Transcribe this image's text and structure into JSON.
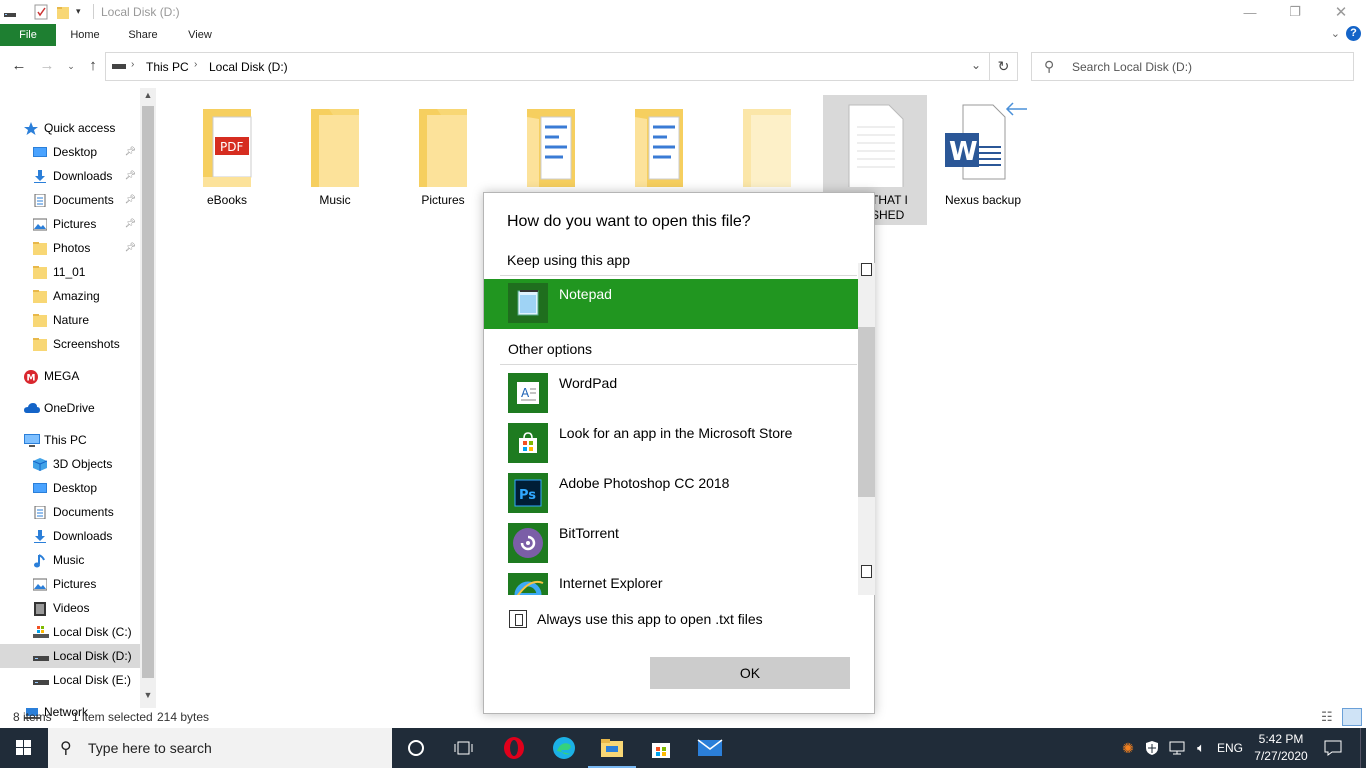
{
  "window": {
    "title": "Local Disk (D:)",
    "controls": {
      "minimize": "—",
      "maximize": "❐",
      "close": "✕"
    }
  },
  "ribbon": {
    "tabs": [
      "File",
      "Home",
      "Share",
      "View"
    ],
    "help": "?"
  },
  "address": {
    "crumbs": [
      "This PC",
      "Local Disk (D:)"
    ],
    "search_placeholder": "Search Local Disk (D:)"
  },
  "nav": {
    "items": [
      {
        "label": "Quick access",
        "icon": "star-icon",
        "pinned": false,
        "level": 0
      },
      {
        "label": "Desktop",
        "icon": "desktop-icon",
        "pinned": true,
        "level": 1
      },
      {
        "label": "Downloads",
        "icon": "download-icon",
        "pinned": true,
        "level": 1
      },
      {
        "label": "Documents",
        "icon": "documents-icon",
        "pinned": true,
        "level": 1
      },
      {
        "label": "Pictures",
        "icon": "pictures-icon",
        "pinned": true,
        "level": 1
      },
      {
        "label": "Photos",
        "icon": "folder-icon",
        "pinned": true,
        "level": 1
      },
      {
        "label": "11_01",
        "icon": "folder-icon",
        "pinned": false,
        "level": 1
      },
      {
        "label": "Amazing",
        "icon": "folder-icon",
        "pinned": false,
        "level": 1
      },
      {
        "label": "Nature",
        "icon": "folder-icon",
        "pinned": false,
        "level": 1
      },
      {
        "label": "Screenshots",
        "icon": "folder-icon",
        "pinned": false,
        "level": 1
      },
      {
        "label": "MEGA",
        "icon": "mega-icon",
        "pinned": false,
        "level": 0
      },
      {
        "label": "OneDrive",
        "icon": "onedrive-icon",
        "pinned": false,
        "level": 0
      },
      {
        "label": "This PC",
        "icon": "pc-icon",
        "pinned": false,
        "level": 0
      },
      {
        "label": "3D Objects",
        "icon": "3d-objects-icon",
        "pinned": false,
        "level": 1
      },
      {
        "label": "Desktop",
        "icon": "desktop-icon",
        "pinned": false,
        "level": 1
      },
      {
        "label": "Documents",
        "icon": "documents-icon",
        "pinned": false,
        "level": 1
      },
      {
        "label": "Downloads",
        "icon": "download-icon",
        "pinned": false,
        "level": 1
      },
      {
        "label": "Music",
        "icon": "music-icon",
        "pinned": false,
        "level": 1
      },
      {
        "label": "Pictures",
        "icon": "pictures-icon",
        "pinned": false,
        "level": 1
      },
      {
        "label": "Videos",
        "icon": "videos-icon",
        "pinned": false,
        "level": 1
      },
      {
        "label": "Local Disk (C:)",
        "icon": "drive-c-icon",
        "pinned": false,
        "level": 1
      },
      {
        "label": "Local Disk (D:)",
        "icon": "drive-icon",
        "pinned": false,
        "level": 1,
        "selected": true
      },
      {
        "label": "Local Disk (E:)",
        "icon": "drive-icon",
        "pinned": false,
        "level": 1
      },
      {
        "label": "Network",
        "icon": "network-icon",
        "pinned": false,
        "level": 0
      }
    ]
  },
  "files": [
    {
      "label": "eBooks",
      "icon": "folder-pdf-icon"
    },
    {
      "label": "Music",
      "icon": "folder-icon"
    },
    {
      "label": "Pictures",
      "icon": "folder-icon"
    },
    {
      "label": "",
      "icon": "folder-docs-icon"
    },
    {
      "label": "",
      "icon": "folder-docs-icon"
    },
    {
      "label": "",
      "icon": "folder-faded-icon"
    },
    {
      "label": "THAT I\nSHED",
      "icon": "text-file-icon",
      "selected": true
    },
    {
      "label": "Nexus backup",
      "icon": "word-shortcut-icon"
    }
  ],
  "status": {
    "count": "8 items",
    "selected": "1 item selected",
    "size": "214 bytes"
  },
  "dialog": {
    "title": "How do you want to open this file?",
    "keep_label": "Keep using this app",
    "current_app": "Notepad",
    "other_label": "Other options",
    "apps": [
      "WordPad",
      "Look for an app in the Microsoft Store",
      "Adobe Photoshop CC 2018",
      "BitTorrent",
      "Internet Explorer"
    ],
    "always_label": "Always use this app to open .txt files",
    "ok_label": "OK"
  },
  "taskbar": {
    "search_placeholder": "Type here to search",
    "language": "ENG",
    "time": "5:42 PM",
    "date": "7/27/2020"
  },
  "colors": {
    "accent_green": "#219620",
    "file_tab": "#1e7f31",
    "folder": "#f8d775",
    "taskbar": "#202c39"
  }
}
